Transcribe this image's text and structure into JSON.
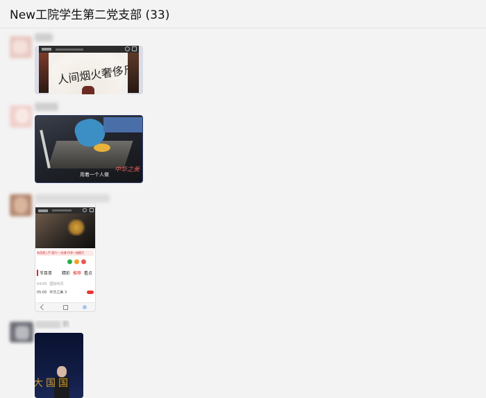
{
  "header": {
    "title": "New工院学生第二党支部 (33)"
  },
  "messages": [
    {
      "avatar_colors": [
        "#e9c9c2",
        "#f3e1da"
      ],
      "sender_name": "",
      "media": {
        "kind": "video-page-screenshot",
        "fan_text": "人间烟火奢侈斤",
        "icons": [
          "search-icon",
          "menu-icon"
        ]
      }
    },
    {
      "avatar_colors": [
        "#f0d0cc",
        "#f9e9e6"
      ],
      "sender_name": "",
      "media": {
        "kind": "video-frame",
        "caption": "用着一个人做",
        "seal": "中华之美"
      }
    },
    {
      "avatar_colors": [
        "#b58a73",
        "#d9b59e"
      ],
      "sender_name": "",
      "media": {
        "kind": "phone-screenshot",
        "banner_text": "有用就上手 国行\"一站通\"作答一遍题目",
        "program_title": "节目单",
        "tabs": [
          "精彩",
          "推荐",
          "看点"
        ],
        "rows": [
          {
            "time": "04:00",
            "name": "国际时讯"
          },
          {
            "time": "05:00",
            "name": "中华之美 3"
          }
        ],
        "icons": [
          "search-icon",
          "menu-icon",
          "wechat-icon",
          "share-icon",
          "back-icon",
          "home-icon"
        ]
      }
    },
    {
      "avatar_colors": [
        "#6f6f78",
        "#b9b9c0"
      ],
      "sender_name": "新",
      "media": {
        "kind": "video-frame-dark",
        "overlay_text": "大国国"
      }
    }
  ]
}
